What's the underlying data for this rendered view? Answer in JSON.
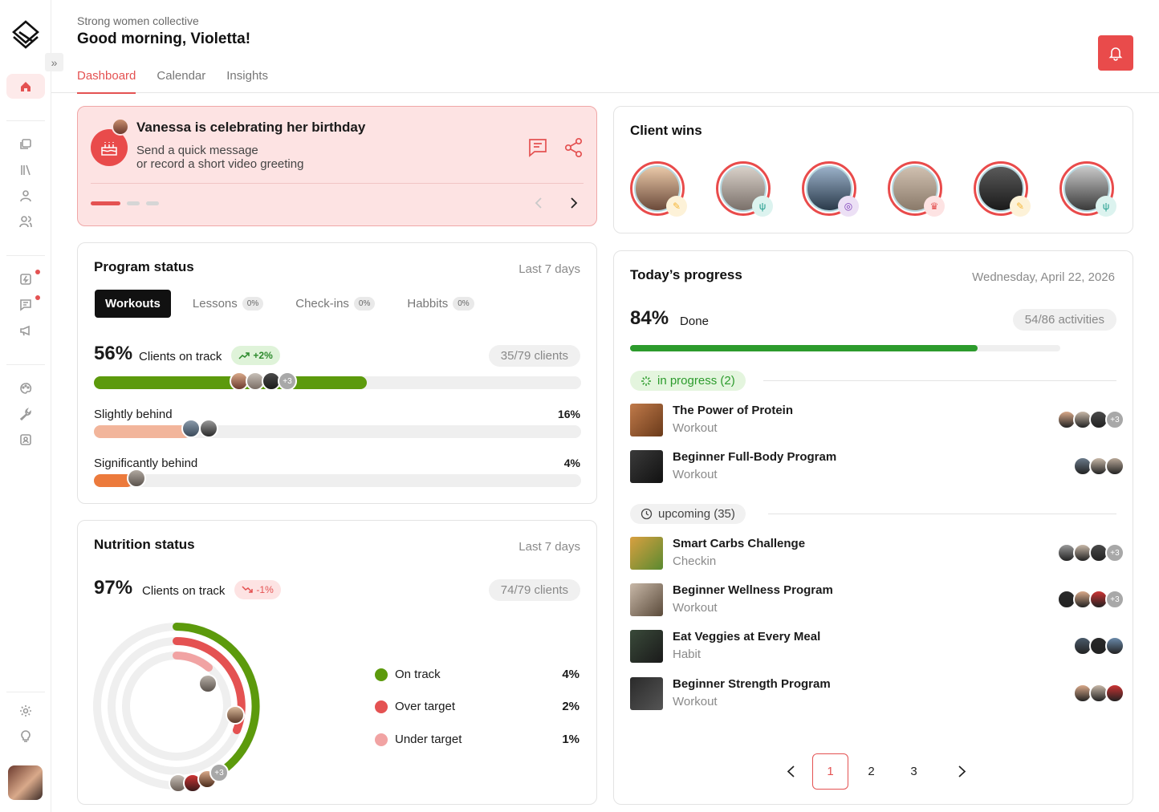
{
  "header": {
    "org": "Strong women collective",
    "greeting": "Good morning, Violetta!",
    "tabs": [
      "Dashboard",
      "Calendar",
      "Insights"
    ]
  },
  "birthday": {
    "title": "Vanessa is celebrating her birthday",
    "line1": "Send a quick message",
    "line2": "or record a short video greeting"
  },
  "wins": {
    "title": "Client wins",
    "badges": [
      "tag-icon",
      "utensils-icon",
      "target-icon",
      "trophy-icon",
      "tag-icon",
      "utensils-icon"
    ]
  },
  "program": {
    "title": "Program status",
    "period": "Last 7 days",
    "tabs": [
      {
        "label": "Workouts",
        "badge": ""
      },
      {
        "label": "Lessons",
        "badge": "0%"
      },
      {
        "label": "Check-ins",
        "badge": "0%"
      },
      {
        "label": "Habbits",
        "badge": "0%"
      }
    ],
    "on_track_pct": "56%",
    "on_track_label": "Clients on track",
    "trend": "+2%",
    "clients": "35/79 clients",
    "on_track_more": "+3",
    "rows": [
      {
        "label": "Slightly behind",
        "value": "16%"
      },
      {
        "label": "Significantly behind",
        "value": "4%"
      }
    ],
    "fills": [
      0.56,
      0.16,
      0.04
    ]
  },
  "nutrition": {
    "title": "Nutrition status",
    "period": "Last 7 days",
    "pct": "97%",
    "label": "Clients on track",
    "trend": "-1%",
    "clients": "74/79 clients",
    "more": "+3",
    "legend": [
      {
        "label": "On track",
        "value": "4%",
        "color": "#5c9a0c"
      },
      {
        "label": "Over target",
        "value": "2%",
        "color": "#e45252"
      },
      {
        "label": "Under target",
        "value": "1%",
        "color": "#f1a3a3"
      }
    ]
  },
  "today": {
    "title": "Today’s progress",
    "date": "Wednesday, April 22, 2026",
    "pct": "84%",
    "done": "Done",
    "activities": "54/86 activities",
    "fill": 0.84,
    "in_progress": "in progress (2)",
    "upcoming": "upcoming (35)",
    "items": [
      {
        "name": "The Power of Protein",
        "type": "Workout",
        "more": "+3"
      },
      {
        "name": "Beginner Full-Body Program",
        "type": "Workout",
        "more": ""
      },
      {
        "name": "Smart Carbs Challenge",
        "type": "Checkin",
        "more": "+3"
      },
      {
        "name": "Beginner Wellness Program",
        "type": "Workout",
        "more": "+3"
      },
      {
        "name": "Eat Veggies at Every Meal",
        "type": "Habit",
        "more": ""
      },
      {
        "name": "Beginner Strength Program",
        "type": "Workout",
        "more": ""
      }
    ],
    "pages": [
      "1",
      "2",
      "3"
    ]
  },
  "colors": {
    "accent": "#e45252",
    "green": "#2c9b2c",
    "olive": "#5c9a0c"
  }
}
